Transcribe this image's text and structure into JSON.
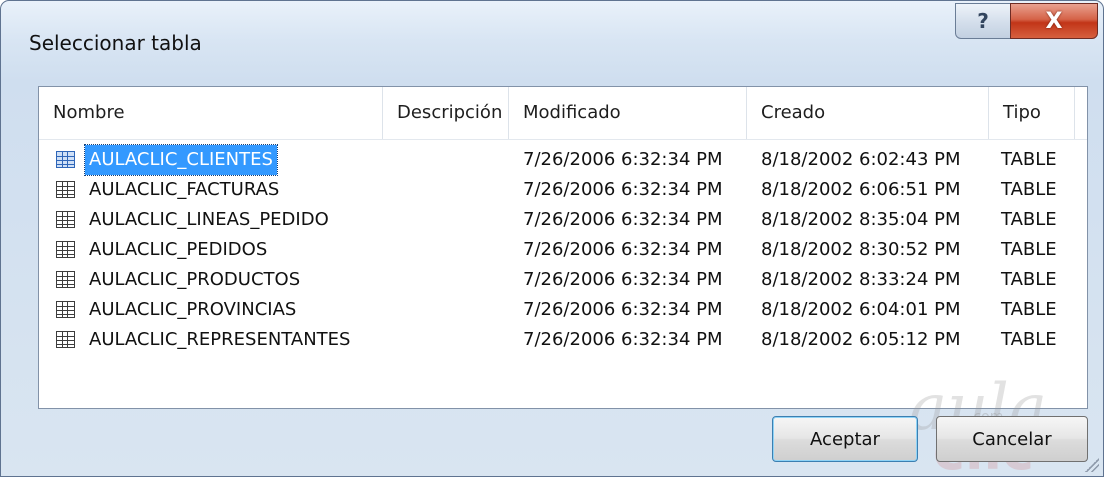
{
  "window": {
    "title": "Seleccionar tabla",
    "help_label": "?",
    "close_label": "X"
  },
  "columns": [
    {
      "label": "Nombre"
    },
    {
      "label": "Descripción"
    },
    {
      "label": "Modificado"
    },
    {
      "label": "Creado"
    },
    {
      "label": "Tipo"
    }
  ],
  "rows": [
    {
      "name": "AULACLIC_CLIENTES",
      "description": "",
      "modified": "7/26/2006 6:32:34 PM",
      "created": "8/18/2002 6:02:43 PM",
      "type": "TABLE",
      "selected": true
    },
    {
      "name": "AULACLIC_FACTURAS",
      "description": "",
      "modified": "7/26/2006 6:32:34 PM",
      "created": "8/18/2002 6:06:51 PM",
      "type": "TABLE",
      "selected": false
    },
    {
      "name": "AULACLIC_LINEAS_PEDIDO",
      "description": "",
      "modified": "7/26/2006 6:32:34 PM",
      "created": "8/18/2002 8:35:04 PM",
      "type": "TABLE",
      "selected": false
    },
    {
      "name": "AULACLIC_PEDIDOS",
      "description": "",
      "modified": "7/26/2006 6:32:34 PM",
      "created": "8/18/2002 8:30:52 PM",
      "type": "TABLE",
      "selected": false
    },
    {
      "name": "AULACLIC_PRODUCTOS",
      "description": "",
      "modified": "7/26/2006 6:32:34 PM",
      "created": "8/18/2002 8:33:24 PM",
      "type": "TABLE",
      "selected": false
    },
    {
      "name": "AULACLIC_PROVINCIAS",
      "description": "",
      "modified": "7/26/2006 6:32:34 PM",
      "created": "8/18/2002 6:04:01 PM",
      "type": "TABLE",
      "selected": false
    },
    {
      "name": "AULACLIC_REPRESENTANTES",
      "description": "",
      "modified": "7/26/2006 6:32:34 PM",
      "created": "8/18/2002 6:05:12 PM",
      "type": "TABLE",
      "selected": false
    }
  ],
  "buttons": {
    "ok_label": "Aceptar",
    "cancel_label": "Cancelar"
  },
  "watermark": {
    "top": "aula",
    "com": ".com",
    "bottom": "clic"
  },
  "icons": {
    "row_icon": "table-grid-icon",
    "help": "help-icon",
    "close": "close-icon"
  },
  "colors": {
    "selection": "#3399ff",
    "close_button": "#c23518",
    "dialog_background": "#d8e5f3"
  }
}
